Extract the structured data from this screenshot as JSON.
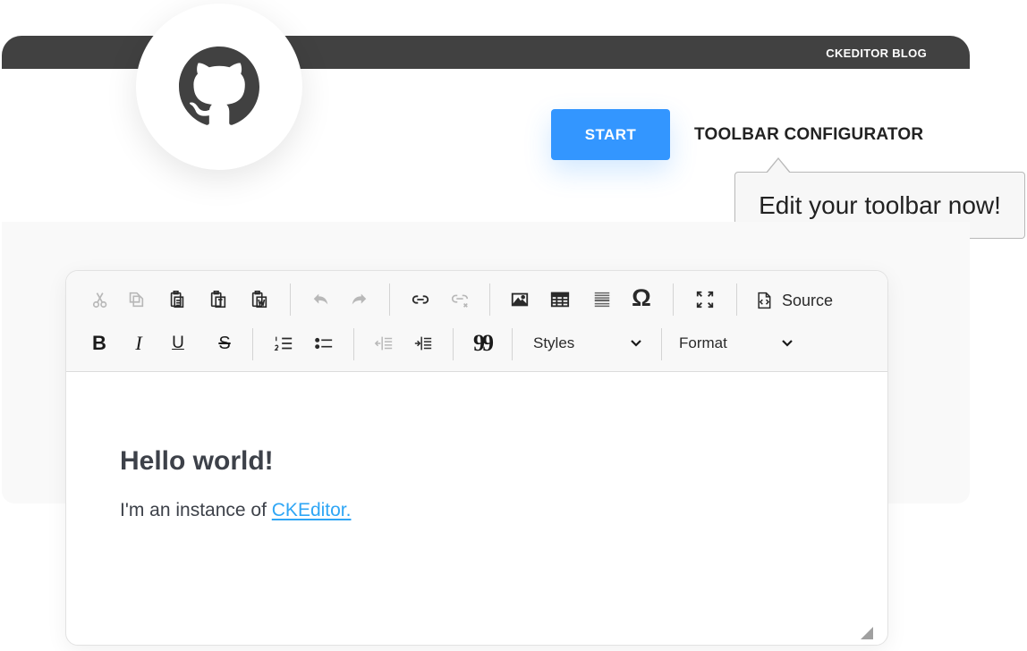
{
  "header": {
    "blog_link": "CKEDITOR BLOG"
  },
  "nav": {
    "start_label": "START",
    "toolbar_config_label": "TOOLBAR CONFIGURATOR",
    "tooltip_text": "Edit your toolbar now!"
  },
  "toolbar": {
    "row1": [
      "cut-icon",
      "copy-icon",
      "paste-icon",
      "paste-text-icon",
      "paste-word-icon",
      "undo-icon",
      "redo-icon",
      "link-icon",
      "unlink-icon",
      "image-icon",
      "table-icon",
      "horizontal-line-icon",
      "special-char-icon",
      "maximize-icon",
      "source-icon"
    ],
    "source_label": "Source",
    "special_char_glyph": "Ω",
    "styles_label": "Styles",
    "format_label": "Format",
    "bold_glyph": "B",
    "italic_glyph": "I",
    "underline_glyph": "U",
    "strike_glyph": "S",
    "quote_glyph": "99"
  },
  "content": {
    "heading": "Hello world!",
    "intro_text": "I'm an instance of ",
    "link_text": "CKEditor."
  },
  "colors": {
    "accent": "#3396ff",
    "topbar": "#414141",
    "link": "#2fa6f5"
  }
}
